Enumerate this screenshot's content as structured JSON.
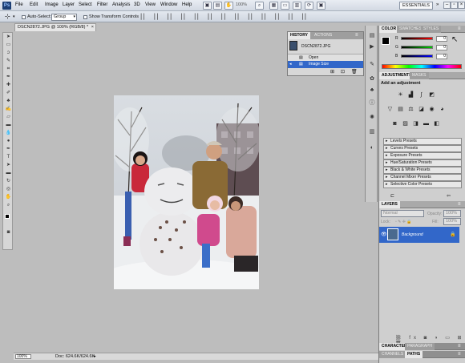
{
  "app": {
    "logo": "Ps"
  },
  "menu": {
    "items": [
      "File",
      "Edit",
      "Image",
      "Layer",
      "Select",
      "Filter",
      "Analysis",
      "3D",
      "View",
      "Window",
      "Help"
    ],
    "zoom": "100%",
    "workspace": "ESSENTIALS"
  },
  "options": {
    "auto_select_label": "Auto-Select:",
    "auto_select_value": "Group",
    "transform_label": "Show Transform Controls"
  },
  "document": {
    "tab_title": "DSCN2872.JPG @ 100% (RGB/8) *",
    "status_zoom": "100%",
    "status_doc": "Doc: 624.6K/624.6K"
  },
  "history": {
    "tab_active": "HISTORY",
    "tab_other": "ACTIONS",
    "snapshot": "DSCN2872.JPG",
    "steps": [
      "Open",
      "Image Size"
    ]
  },
  "color": {
    "tabs": [
      "COLOR",
      "SWATCHES",
      "STYLES"
    ],
    "channels": [
      {
        "name": "R",
        "value": "0"
      },
      {
        "name": "G",
        "value": "0"
      },
      {
        "name": "B",
        "value": "0"
      }
    ]
  },
  "adjustments": {
    "tabs": [
      "ADJUSTMENTS",
      "MASKS"
    ],
    "heading": "Add an adjustment",
    "presets": [
      "Levels Presets",
      "Curves Presets",
      "Exposure Presets",
      "Hue/Saturation Presets",
      "Black & White Presets",
      "Channel Mixer Presets",
      "Selective Color Presets"
    ]
  },
  "layers": {
    "tab": "LAYERS",
    "blend_mode": "Normal",
    "opacity_label": "Opacity:",
    "opacity_value": "100%",
    "lock_label": "Lock:",
    "fill_label": "Fill:",
    "fill_value": "100%",
    "layer_name": "Background"
  },
  "bottom_tabs": {
    "row1": [
      "CHARACTER",
      "PARAGRAPH"
    ],
    "row2": [
      "CHANNELS",
      "PATHS"
    ]
  },
  "colors": {
    "selection": "#3267c9",
    "menubar": "#d8dee7",
    "canvas_bg": "#bdbdbd"
  }
}
